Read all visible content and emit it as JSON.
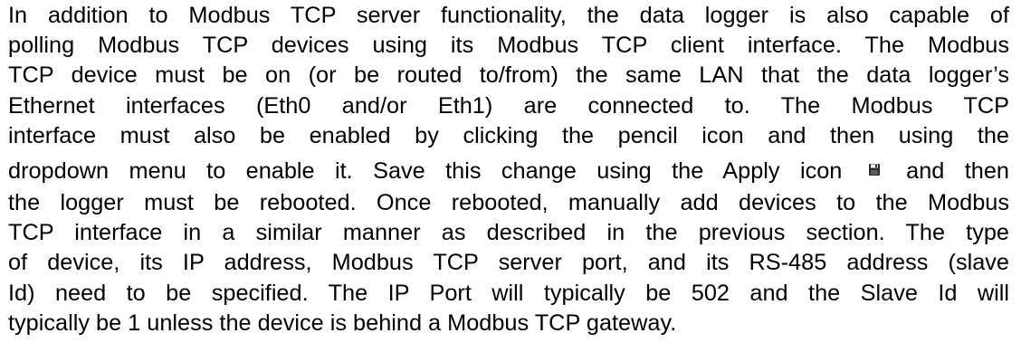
{
  "document": {
    "lines": [
      "In addition to Modbus TCP server functionality, the data logger is also capable of",
      "polling Modbus TCP devices using its Modbus TCP client interface. The Modbus",
      "TCP device must be on (or be routed to/from) the same LAN that the data logger’s",
      "Ethernet interfaces (Eth0 and/or Eth1) are connected to. The Modbus TCP",
      "interface must also be enabled by clicking the pencil icon and then using the",
      "dropdown menu to enable it. Save this change using the Apply icon",
      "and then",
      "the logger must be rebooted. Once rebooted, manually add devices to the Modbus",
      "TCP interface in a similar manner as described in the previous section. The type",
      "of device, its IP address, Modbus TCP server port, and its RS-485 address (slave",
      "Id) need to be specified. The IP Port will typically be 502 and the Slave Id will",
      "typically be 1 unless the device is behind a Modbus TCP gateway."
    ],
    "icons": {
      "apply": "floppy-disk-save-icon"
    },
    "colors": {
      "text": "#000000",
      "icon_fill": "#2a2a2a",
      "background": "#ffffff"
    }
  }
}
